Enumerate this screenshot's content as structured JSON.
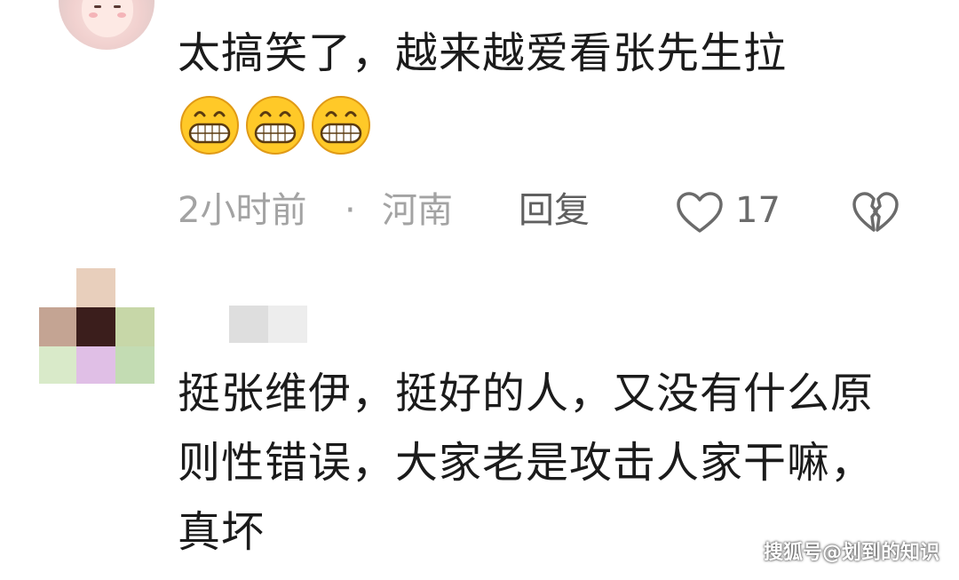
{
  "comment1": {
    "text": "太搞笑了，越来越爱看张先生拉",
    "emojis": [
      "grinning-face-icon",
      "grinning-face-icon",
      "grinning-face-icon"
    ],
    "time": "2小时前",
    "separator": "·",
    "location": "河南",
    "reply_label": "回复",
    "like_count": "17"
  },
  "comment2": {
    "text": "挺张维伊，挺好的人，又没有什么原则性错误，大家老是攻击人家干嘛，真坏"
  },
  "watermark": "搜狐号@划到的知识",
  "colors": {
    "text": "#1b1b1b",
    "meta": "#a3a3a3",
    "action": "#5f5f5f",
    "emoji_face": "#ffc928",
    "emoji_outline": "#e09a16"
  }
}
